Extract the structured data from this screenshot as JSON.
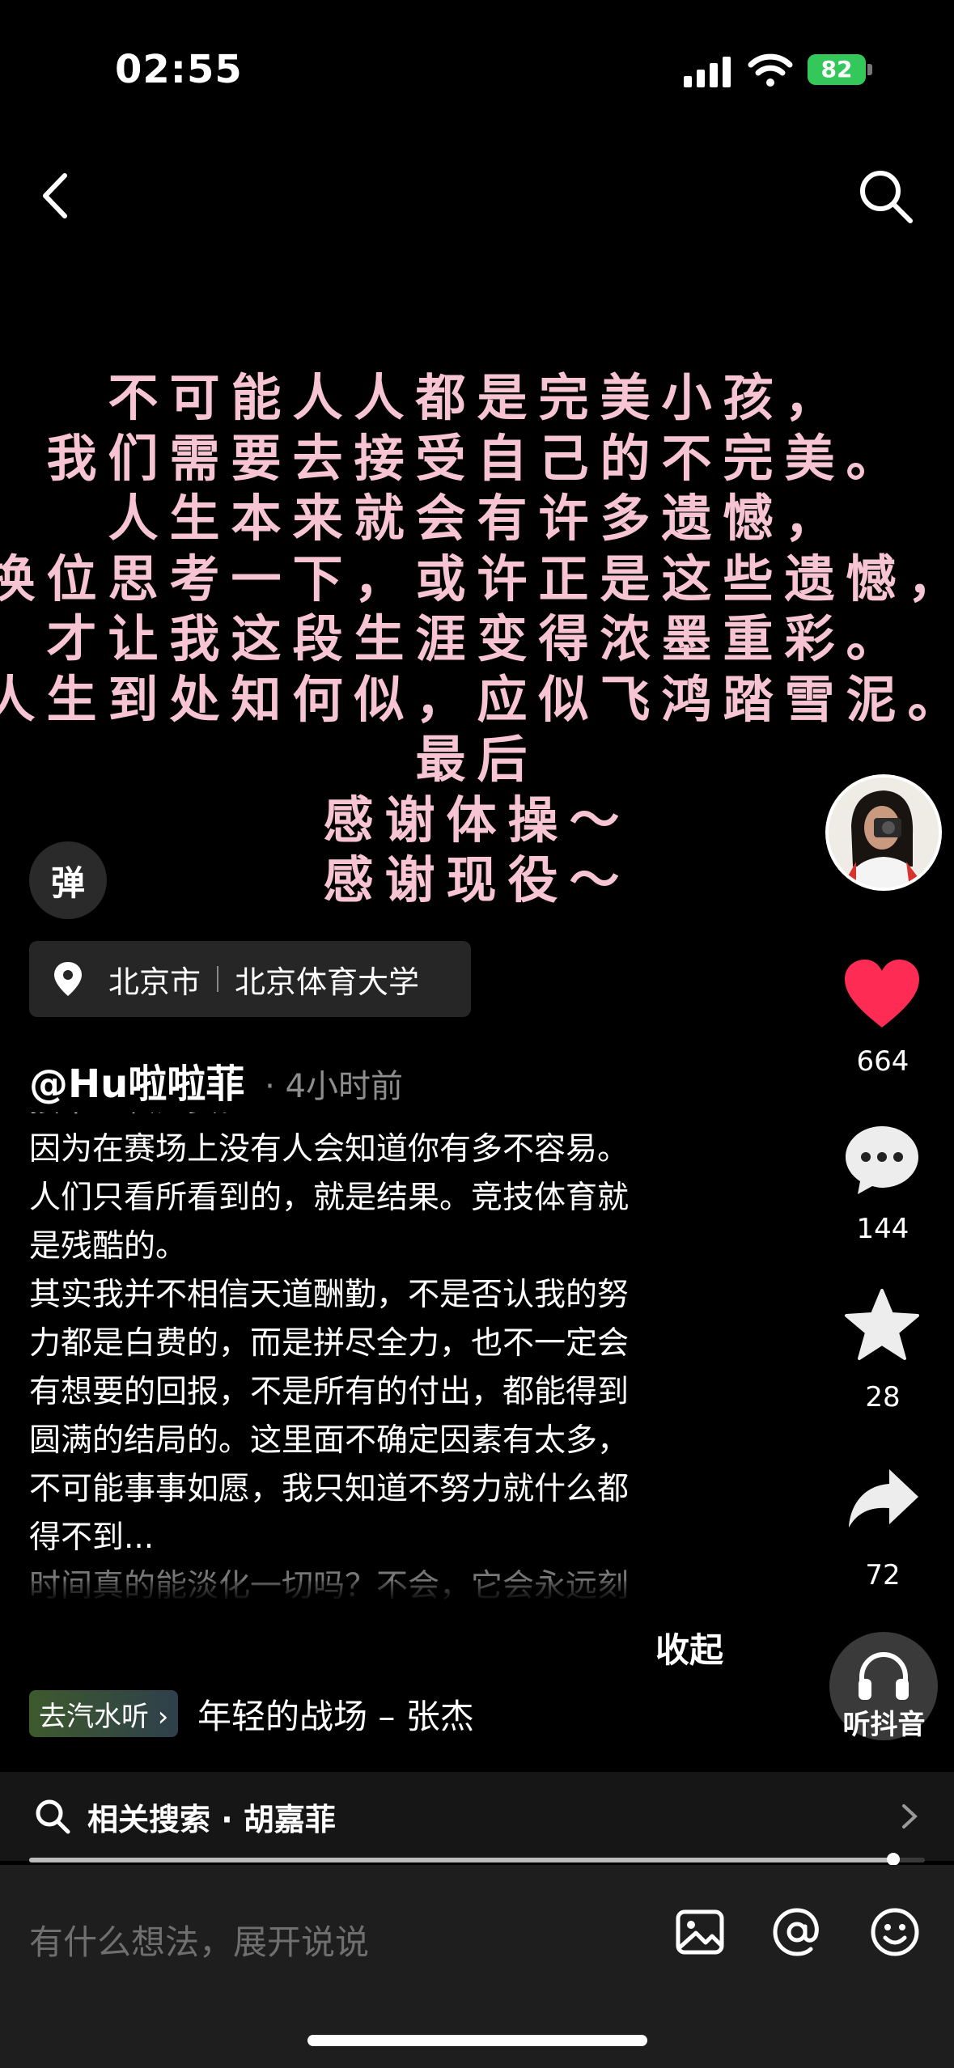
{
  "status_bar": {
    "time": "02:55",
    "battery": "82"
  },
  "nav": {
    "back": "back",
    "search": "search"
  },
  "overlay_text": [
    "不可能人人都是完美小孩，",
    "我们需要去接受自己的不完美。",
    "人生本来就会有许多遗憾，",
    "换位思考一下，或许正是这些遗憾，",
    "才让我这段生涯变得浓墨重彩。",
    "人生到处知何似，应似飞鸿踏雪泥。",
    "最后",
    "感谢体操～",
    "感谢现役～"
  ],
  "danmu": {
    "label": "弹"
  },
  "location": {
    "city": "北京市",
    "place": "北京体育大学"
  },
  "author": {
    "name": "@Hu啦啦菲",
    "time": "· 4小时前"
  },
  "description": [
    "接下一次比赛。",
    "因为在赛场上没有人会知道你有多不容易。",
    "人们只看所看到的，就是结果。竞技体育就",
    "是残酷的。",
    "其实我并不相信天道酬勤，不是否认我的努",
    "力都是白费的，而是拼尽全力，也不一定会",
    "有想要的回报，不是所有的付出，都能得到",
    "圆满的结局的。这里面不确定因素有太多，",
    "不可能事事如愿，我只知道不努力就什么都",
    "得不到...",
    "时间真的能淡化一切吗？不会，它会永远刻"
  ],
  "collapse_label": "收起",
  "music": {
    "tag": "去汽水听 ›",
    "title": "年轻的战场 – 张杰"
  },
  "actions": {
    "likes": "664",
    "comments": "144",
    "favorites": "28",
    "shares": "72",
    "listen": "听抖音"
  },
  "related_search": {
    "label": "相关搜索 · 胡嘉菲"
  },
  "progress": {
    "value": 0.965
  },
  "comment": {
    "placeholder": "有什么想法，展开说说"
  },
  "colors": {
    "accent_like": "#fe2c55",
    "caption_pink": "#f6c4d2",
    "battery_green": "#34c759"
  }
}
